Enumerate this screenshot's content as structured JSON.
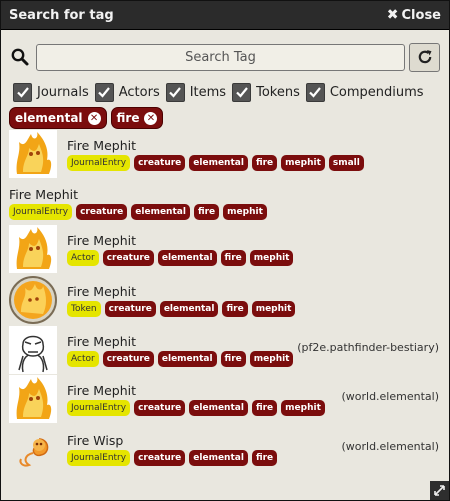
{
  "window": {
    "title": "Search for tag",
    "close_label": "Close"
  },
  "search": {
    "placeholder": "Search Tag",
    "value": ""
  },
  "filters": [
    {
      "label": "Journals",
      "checked": true
    },
    {
      "label": "Actors",
      "checked": true
    },
    {
      "label": "Items",
      "checked": true
    },
    {
      "label": "Tokens",
      "checked": true
    },
    {
      "label": "Compendiums",
      "checked": true
    }
  ],
  "active_tags": [
    "elemental",
    "fire"
  ],
  "results": [
    {
      "name": "Fire Mephit",
      "type": "JournalEntry",
      "tags": [
        "creature",
        "elemental",
        "fire",
        "mephit",
        "small"
      ],
      "source": "",
      "thumb": "mephit-image"
    },
    {
      "name": "Fire Mephit",
      "type": "JournalEntry",
      "tags": [
        "creature",
        "elemental",
        "fire",
        "mephit"
      ],
      "source": "",
      "thumb": ""
    },
    {
      "name": "Fire Mephit",
      "type": "Actor",
      "tags": [
        "creature",
        "elemental",
        "fire",
        "mephit"
      ],
      "source": "",
      "thumb": "mephit-image"
    },
    {
      "name": "Fire Mephit",
      "type": "Token",
      "tags": [
        "creature",
        "elemental",
        "fire",
        "mephit"
      ],
      "source": "",
      "thumb": "token-image"
    },
    {
      "name": "Fire Mephit",
      "type": "Actor",
      "tags": [
        "creature",
        "elemental",
        "fire",
        "mephit"
      ],
      "source": "(pf2e.pathfinder-bestiary)",
      "thumb": "mystery-man-image"
    },
    {
      "name": "Fire Mephit",
      "type": "JournalEntry",
      "tags": [
        "creature",
        "elemental",
        "fire",
        "mephit"
      ],
      "source": "(world.elemental)",
      "thumb": "mephit-image"
    },
    {
      "name": "Fire Wisp",
      "type": "JournalEntry",
      "tags": [
        "creature",
        "elemental",
        "fire"
      ],
      "source": "(world.elemental)",
      "thumb": "wisp-image"
    }
  ],
  "colors": {
    "tag_bg": "#7b0d0d",
    "type_bg": "#e5e500",
    "titlebar_bg": "#2b2b2b",
    "panel_bg": "#e9e7df"
  }
}
